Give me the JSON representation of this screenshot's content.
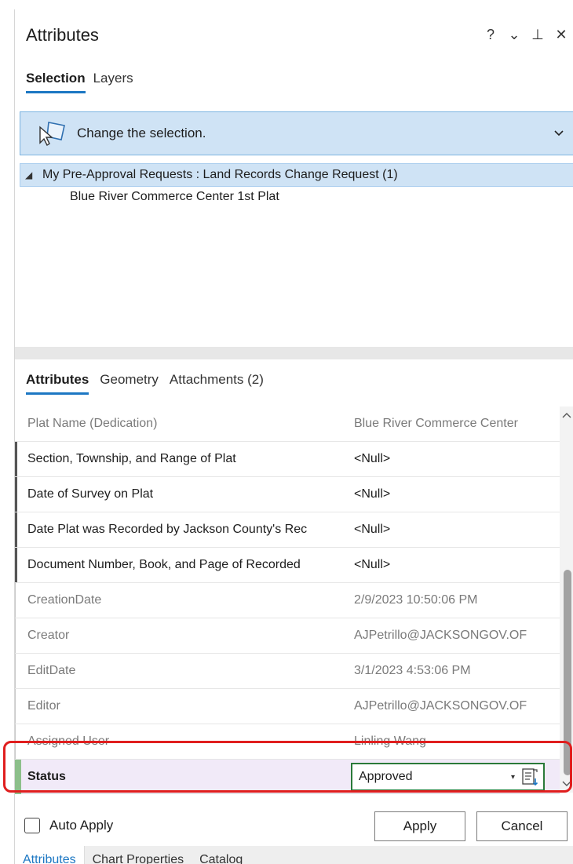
{
  "pane": {
    "title": "Attributes",
    "actions": {
      "help": "?",
      "options": "⌄",
      "pin": "⊥",
      "close": "✕"
    }
  },
  "top_tabs": [
    {
      "label": "Selection",
      "active": true
    },
    {
      "label": "Layers",
      "active": false
    }
  ],
  "selection_dropdown": {
    "label": "Change the selection.",
    "icon": "selection-tool-icon",
    "chevron": "⌄"
  },
  "tree": {
    "parent": "My Pre-Approval Requests : Land Records Change Request (1)",
    "child": "Blue River Commerce Center 1st Plat"
  },
  "mid_tabs": [
    {
      "label": "Attributes",
      "active": true
    },
    {
      "label": "Geometry",
      "active": false
    },
    {
      "label": "Attachments (2)",
      "active": false
    }
  ],
  "rows": [
    {
      "field": "Plat Name (Dedication)",
      "value": "Blue River Commerce Center",
      "style": "first"
    },
    {
      "field": "Section, Township, and Range of Plat",
      "value": "<Null>",
      "style": "editable"
    },
    {
      "field": "Date of Survey on Plat",
      "value": "<Null>",
      "style": "editable"
    },
    {
      "field": "Date Plat was Recorded by Jackson County's Rec",
      "value": "<Null>",
      "style": "editable"
    },
    {
      "field": "Document Number, Book, and Page of Recorded",
      "value": "<Null>",
      "style": "editable"
    },
    {
      "field": "CreationDate",
      "value": "2/9/2023 10:50:06 PM",
      "style": "readonly"
    },
    {
      "field": "Creator",
      "value": "AJPetrillo@JACKSONGOV.OF",
      "style": "readonly"
    },
    {
      "field": "EditDate",
      "value": "3/1/2023 4:53:06 PM",
      "style": "readonly"
    },
    {
      "field": "Editor",
      "value": "AJPetrillo@JACKSONGOV.OF",
      "style": "readonly"
    },
    {
      "field": "Assigned User",
      "value": "Linling Wang",
      "style": "readonly"
    }
  ],
  "status_row": {
    "field": "Status",
    "value": "Approved",
    "caret": "▾",
    "icon": "field-calculator-icon"
  },
  "footer": {
    "auto_apply_label": "Auto Apply",
    "auto_apply_checked": false,
    "apply_label": "Apply",
    "cancel_label": "Cancel"
  },
  "bottom_tabs": [
    {
      "label": "Attributes",
      "active": true
    },
    {
      "label": "Chart Properties",
      "active": false
    },
    {
      "label": "Catalog",
      "active": false
    }
  ],
  "colors": {
    "accent_blue": "#1c77c3",
    "selection_bg": "#cfe3f5",
    "highlight_red": "#e01e1e",
    "status_green": "#2b7a3a",
    "status_row_bg": "#f1eaf8"
  }
}
